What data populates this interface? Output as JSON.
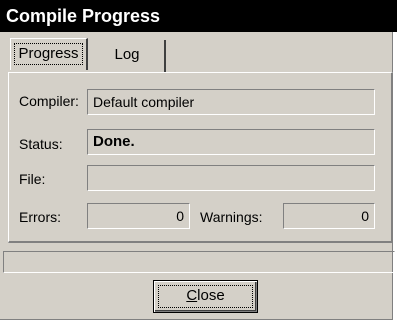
{
  "window": {
    "title": "Compile Progress"
  },
  "tabs": [
    {
      "label": "Progress",
      "active": true
    },
    {
      "label": "Log",
      "active": false
    }
  ],
  "fields": {
    "compiler": {
      "label": "Compiler:",
      "value": "Default compiler"
    },
    "status": {
      "label": "Status:",
      "value": "Done."
    },
    "file": {
      "label": "File:",
      "value": ""
    },
    "errors": {
      "label": "Errors:",
      "value": "0"
    },
    "warnings": {
      "label": "Warnings:",
      "value": "0"
    }
  },
  "statusbar": {
    "text": ""
  },
  "buttons": {
    "close": {
      "label_underlined": "C",
      "label_rest": "lose"
    }
  },
  "colors": {
    "title_bg": "#000000",
    "title_fg": "#ffffff",
    "face": "#d4d0c8"
  }
}
